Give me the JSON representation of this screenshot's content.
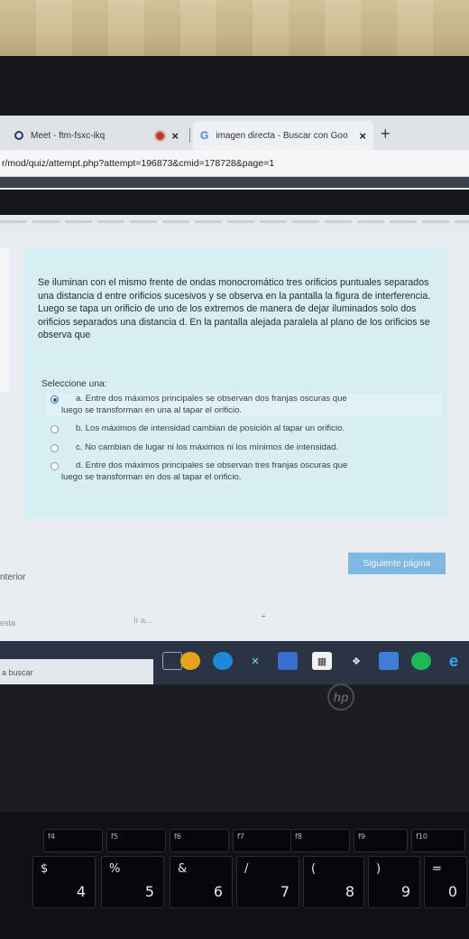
{
  "browser": {
    "tabs": [
      {
        "label": "Meet - ftm-fsxc-ikq",
        "icon": "meet-icon"
      },
      {
        "label": "imagen directa - Buscar con Goo",
        "icon": "google-icon"
      }
    ],
    "new_tab": "+",
    "close": "×",
    "url": "r/mod/quiz/attempt.php?attempt=196873&cmid=178728&page=1"
  },
  "question": {
    "text": "Se iluminan con el mismo frente de ondas monocromático tres orificios puntuales separados una distancia d entre orificios sucesivos y se observa en la pantalla la figura de interferencia. Luego se tapa un orificio de uno de los extremos de manera de dejar iluminados solo dos orificios separados una distancia d. En la pantalla alejada paralela al plano de los orificios se observa que",
    "prompt": "Seleccione una:",
    "answers": [
      {
        "label": "a. Entre dos máximos principales se observan dos franjas oscuras que",
        "cont": "luego se transforman en una al tapar el orificio.",
        "selected": true
      },
      {
        "label": "b. Los máximos de intensidad cambian de posición al tapar un orificio.",
        "cont": "",
        "selected": false
      },
      {
        "label": "c. No cambian de lugar ni los máximos ni los mínimos de intensidad.",
        "cont": "",
        "selected": false
      },
      {
        "label": "d. Entre dos máximos principales se observan tres franjas oscuras que",
        "cont": "luego se transforman en dos al tapar el orificio.",
        "selected": false
      }
    ]
  },
  "nav": {
    "next_label": "Siguiente página",
    "prev_label": "nterior",
    "jump_left": "esta",
    "jump_label": "Ir a...",
    "jump_arrow": "÷"
  },
  "taskbar": {
    "search_placeholder": "a buscar"
  },
  "keyboard": {
    "fkeys": [
      "f4",
      "f5",
      "f6",
      "f7",
      "f8",
      "f9",
      "f10"
    ],
    "numkeys": [
      {
        "top": "$",
        "bot": "4"
      },
      {
        "top": "%",
        "bot": "5"
      },
      {
        "top": "&",
        "bot": "6"
      },
      {
        "top": "/",
        "bot": "7"
      },
      {
        "top": "(",
        "bot": "8"
      },
      {
        "top": ")",
        "bot": "9"
      },
      {
        "top": "=",
        "bot": "0"
      }
    ]
  },
  "brand": "hp"
}
